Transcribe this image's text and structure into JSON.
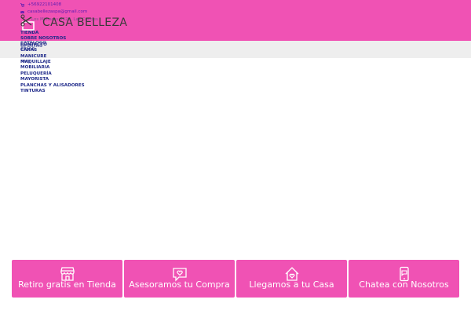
{
  "colors": {
    "brand_pink": "#f052b4",
    "nav_text": "#1f2a8a",
    "gray_band": "#eeeeee"
  },
  "contact": {
    "phone": "+56922101408",
    "email": "casabellezaspa@gmail.com",
    "address": "Los Militares 5620, Las Condes"
  },
  "logo": {
    "part1": "CASA",
    "part2": "BELLEZA"
  },
  "menu": [
    "TIENDA",
    "SOBRE NOSOTROS",
    "CONTACTO",
    "CARAS",
    "MANICURE",
    "MAQUILLAJE",
    "MOBILIARIA",
    "PELUQUERÍA",
    "MAYORISTA",
    "PLANCHAS Y ALISADORES",
    "TINTURAS"
  ],
  "menu_overlap": [
    "CATÁLOGO",
    "OFERTAS",
    "CEJAS",
    "FAQ"
  ],
  "features": [
    {
      "icon": "shop-icon",
      "label": "Retiro gratis en Tienda"
    },
    {
      "icon": "chat-heart-icon",
      "label": "Asesoramos tu Compra"
    },
    {
      "icon": "house-heart-icon",
      "label": "Llegamos a tu Casa"
    },
    {
      "icon": "phone-chat-icon",
      "label": "Chatea con Nosotros"
    }
  ]
}
